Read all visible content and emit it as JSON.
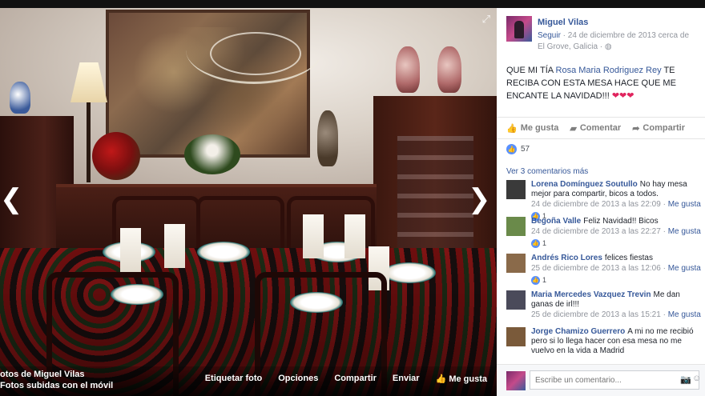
{
  "photo": {
    "prev_arrow": "❮",
    "next_arrow": "❯",
    "expand_icon": "⤢"
  },
  "footer": {
    "album_title": "otos de Miguel Vilas",
    "album_sub": "Fotos subidas con el móvil",
    "actions": [
      "Etiquetar foto",
      "Opciones",
      "Compartir",
      "Enviar",
      "Me gusta"
    ]
  },
  "post": {
    "author": "Miguel Vilas",
    "follow": "Seguir",
    "meta": " · 24 de diciembre de 2013 cerca de El Grove, Galicia · ",
    "text_prefix": "QUE MI TÍA ",
    "mention": "Rosa Maria Rodriguez Rey",
    "text_suffix": " TE RECIBA CON ESTA MESA HACE QUE ME ENCANTE LA NAVIDAD!!! ",
    "hearts": "❤❤❤",
    "like_label": "Me gusta",
    "comment_label": "Comentar",
    "share_label": "Compartir",
    "likes_count": "57",
    "more_comments": "Ver 3 comentarios más"
  },
  "comments": [
    {
      "name": "Lorena Domínguez Soutullo",
      "text": "No hay mesa mejor para compartir, bicos a todos.",
      "time": "24 de diciembre de 2013 a las 22:09",
      "like_link": "Me gusta",
      "likes": "1",
      "avatar_color": "#3a3a3a"
    },
    {
      "name": "Begoña Valle",
      "text": "Feliz Navidad!! Bicos",
      "time": "24 de diciembre de 2013 a las 22:27",
      "like_link": "Me gusta",
      "likes": "1",
      "avatar_color": "#6a8a4a"
    },
    {
      "name": "Andrés Rico Lores",
      "text": "felices fiestas",
      "time": "25 de diciembre de 2013 a las 12:06",
      "like_link": "Me gusta",
      "likes": "1",
      "avatar_color": "#8a6a4a"
    },
    {
      "name": "Maria Mercedes Vazquez Trevin",
      "text": "Me dan ganas de irl!!!",
      "time": "25 de diciembre de 2013 a las 15:21",
      "like_link": "Me gusta",
      "likes": "",
      "avatar_color": "#4a4a5a"
    },
    {
      "name": "Jorge Chamizo Guerrero",
      "text": "A mi no me recibió pero si lo llega hacer con esa mesa no me vuelvo en la vida a Madrid",
      "time": "",
      "like_link": "",
      "likes": "",
      "avatar_color": "#7a5a3a"
    }
  ],
  "composer": {
    "placeholder": "Escribe un comentario...",
    "camera_icon": "📷",
    "emoji_icon": "☺"
  }
}
